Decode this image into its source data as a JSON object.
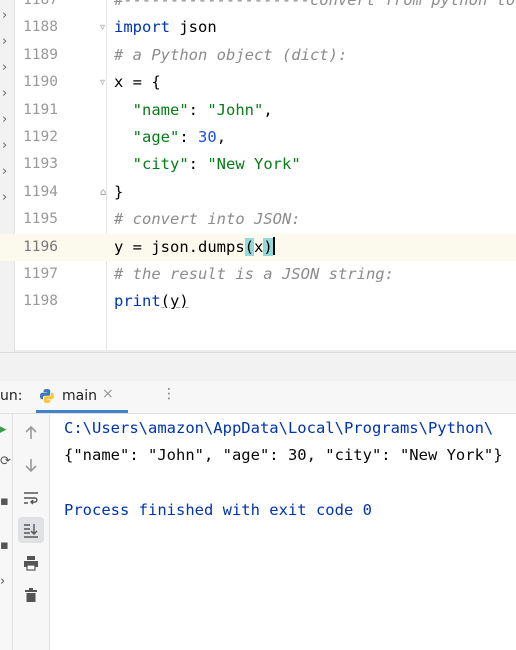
{
  "editor": {
    "lines": [
      {
        "num": "1187",
        "text": "#--------------------convert from python to json"
      },
      {
        "num": "1188",
        "tokens": [
          {
            "t": "import",
            "c": "kw"
          },
          {
            "t": " json",
            "c": "fn"
          }
        ]
      },
      {
        "num": "1189",
        "tokens": [
          {
            "t": "# a Python object (dict):",
            "c": "cm"
          }
        ]
      },
      {
        "num": "1190",
        "tokens": [
          {
            "t": "x = {",
            "c": "fn"
          }
        ]
      },
      {
        "num": "1191",
        "tokens": [
          {
            "t": "  ",
            "c": "fn"
          },
          {
            "t": "\"name\"",
            "c": "str"
          },
          {
            "t": ": ",
            "c": "fn"
          },
          {
            "t": "\"John\"",
            "c": "str"
          },
          {
            "t": ",",
            "c": "fn"
          }
        ]
      },
      {
        "num": "1192",
        "tokens": [
          {
            "t": "  ",
            "c": "fn"
          },
          {
            "t": "\"age\"",
            "c": "str"
          },
          {
            "t": ": ",
            "c": "fn"
          },
          {
            "t": "30",
            "c": "num"
          },
          {
            "t": ",",
            "c": "fn"
          }
        ]
      },
      {
        "num": "1193",
        "tokens": [
          {
            "t": "  ",
            "c": "fn"
          },
          {
            "t": "\"city\"",
            "c": "str"
          },
          {
            "t": ": ",
            "c": "fn"
          },
          {
            "t": "\"New York\"",
            "c": "str"
          }
        ]
      },
      {
        "num": "1194",
        "tokens": [
          {
            "t": "}",
            "c": "fn"
          }
        ]
      },
      {
        "num": "1195",
        "tokens": [
          {
            "t": "# convert into JSON:",
            "c": "cm"
          }
        ]
      },
      {
        "num": "1196",
        "current": true
      },
      {
        "num": "1197",
        "tokens": [
          {
            "t": "# the result is a JSON string:",
            "c": "cm"
          }
        ]
      },
      {
        "num": "1198",
        "tokens": [
          {
            "t": "print",
            "c": "kw"
          },
          {
            "t": "(y)",
            "c": "fn"
          }
        ]
      }
    ],
    "current_line": {
      "prefix": "y = json.dumps",
      "open": "(",
      "arg": "x",
      "close": ")"
    }
  },
  "run": {
    "label": "un:",
    "tab_title": "main",
    "tab_close": "×",
    "more": "⋮"
  },
  "console": {
    "path_line": "C:\\Users\\amazon\\AppData\\Local\\Programs\\Python\\",
    "output_line": "{\"name\": \"John\", \"age\": 30, \"city\": \"New York\"}",
    "exit_line": "Process finished with exit code 0"
  },
  "colors": {
    "keyword": "#0033b3",
    "string": "#067d17",
    "number": "#1750eb",
    "comment": "#8c8c8c",
    "tab_underline": "#4083c9"
  }
}
